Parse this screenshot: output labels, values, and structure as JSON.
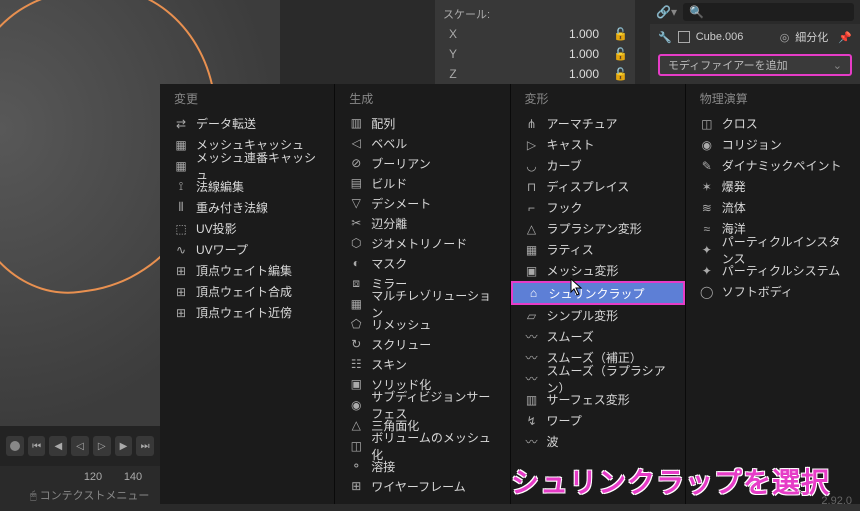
{
  "scale": {
    "label": "スケール:",
    "x": "X",
    "y": "Y",
    "z": "Z",
    "vx": "1.000",
    "vy": "1.000",
    "vz": "1.000"
  },
  "object_name": "Cube.006",
  "subdiv": "細分化",
  "add_modifier": "モディファイアーを追加",
  "context_menu": "コンテクストメニュー",
  "frames": {
    "a": "120",
    "b": "140"
  },
  "columns": {
    "modify": {
      "header": "変更",
      "items": [
        "データ転送",
        "メッシュキャッシュ",
        "メッシュ連番キャッシュ",
        "法線編集",
        "重み付き法線",
        "UV投影",
        "UVワープ",
        "頂点ウェイト編集",
        "頂点ウェイト合成",
        "頂点ウェイト近傍"
      ]
    },
    "generate": {
      "header": "生成",
      "items": [
        "配列",
        "ベベル",
        "ブーリアン",
        "ビルド",
        "デシメート",
        "辺分離",
        "ジオメトリノード",
        "マスク",
        "ミラー",
        "マルチレゾリューション",
        "リメッシュ",
        "スクリュー",
        "スキン",
        "ソリッド化",
        "サブディビジョンサーフェス",
        "三角面化",
        "ボリュームのメッシュ化",
        "溶接",
        "ワイヤーフレーム"
      ]
    },
    "deform": {
      "header": "変形",
      "items": [
        "アーマチュア",
        "キャスト",
        "カーブ",
        "ディスプレイス",
        "フック",
        "ラプラシアン変形",
        "ラティス",
        "メッシュ変形",
        "シュリンクラップ",
        "シンプル変形",
        "スムーズ",
        "スムーズ（補正）",
        "スムーズ（ラプラシアン）",
        "サーフェス変形",
        "ワープ",
        "波"
      ]
    },
    "physics": {
      "header": "物理演算",
      "items": [
        "クロス",
        "コリジョン",
        "ダイナミックペイント",
        "爆発",
        "流体",
        "海洋",
        "パーティクルインスタンス",
        "パーティクルシステム",
        "ソフトボディ"
      ]
    }
  },
  "selected_item": "シュリンクラップ",
  "caption": "シュリンクラップを選択",
  "version": "2.92.0"
}
